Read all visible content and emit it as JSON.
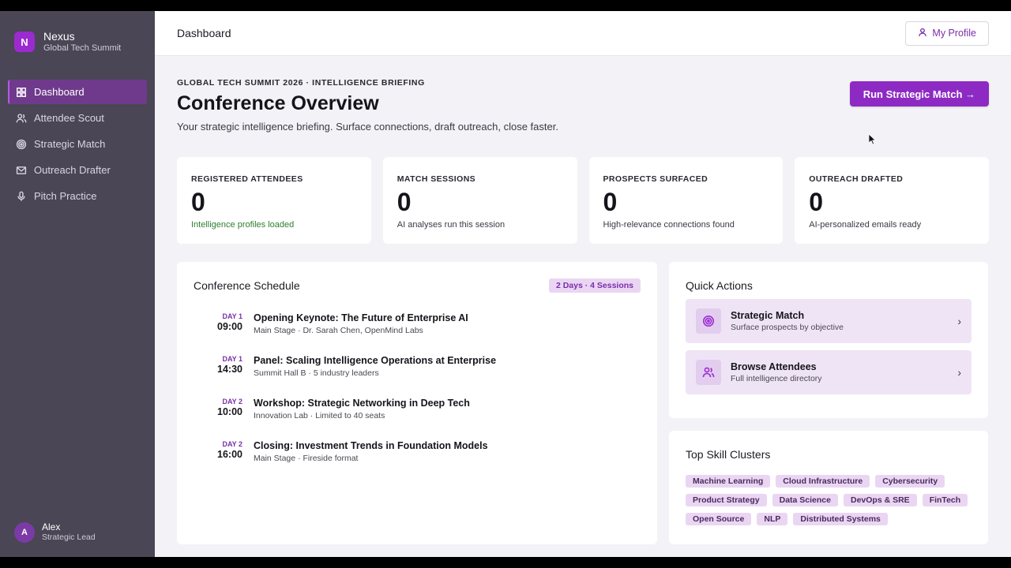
{
  "brand": {
    "logo_letter": "N",
    "name": "Nexus",
    "subtitle": "Global Tech Summit"
  },
  "nav": [
    {
      "label": "Dashboard",
      "icon": "grid-icon",
      "active": true
    },
    {
      "label": "Attendee Scout",
      "icon": "users-icon",
      "active": false
    },
    {
      "label": "Strategic Match",
      "icon": "target-icon",
      "active": false
    },
    {
      "label": "Outreach Drafter",
      "icon": "mail-icon",
      "active": false
    },
    {
      "label": "Pitch Practice",
      "icon": "mic-icon",
      "active": false
    }
  ],
  "user": {
    "initial": "A",
    "name": "Alex",
    "role": "Strategic Lead"
  },
  "topbar": {
    "title": "Dashboard",
    "profile_label": "My Profile"
  },
  "hero": {
    "kicker": "GLOBAL TECH SUMMIT 2026 · INTELLIGENCE BRIEFING",
    "title": "Conference Overview",
    "lede": "Your strategic intelligence briefing. Surface connections, draft outreach, close faster.",
    "cta": "Run Strategic Match →"
  },
  "stats": [
    {
      "label": "REGISTERED ATTENDEES",
      "value": "0",
      "note": "Intelligence profiles loaded"
    },
    {
      "label": "MATCH SESSIONS",
      "value": "0",
      "note": "AI analyses run this session"
    },
    {
      "label": "PROSPECTS SURFACED",
      "value": "0",
      "note": "High-relevance connections found"
    },
    {
      "label": "OUTREACH DRAFTED",
      "value": "0",
      "note": "AI-personalized emails ready"
    }
  ],
  "schedule": {
    "title": "Conference Schedule",
    "badge": "2 Days · 4 Sessions",
    "sessions": [
      {
        "day": "DAY 1",
        "time": "09:00",
        "title": "Opening Keynote: The Future of Enterprise AI",
        "sub": "Main Stage · Dr. Sarah Chen, OpenMind Labs"
      },
      {
        "day": "DAY 1",
        "time": "14:30",
        "title": "Panel: Scaling Intelligence Operations at Enterprise",
        "sub": "Summit Hall B · 5 industry leaders"
      },
      {
        "day": "DAY 2",
        "time": "10:00",
        "title": "Workshop: Strategic Networking in Deep Tech",
        "sub": "Innovation Lab · Limited to 40 seats"
      },
      {
        "day": "DAY 2",
        "time": "16:00",
        "title": "Closing: Investment Trends in Foundation Models",
        "sub": "Main Stage · Fireside format"
      }
    ]
  },
  "quick_actions": {
    "title": "Quick Actions",
    "items": [
      {
        "title": "Strategic Match",
        "sub": "Surface prospects by objective",
        "icon": "target-icon"
      },
      {
        "title": "Browse Attendees",
        "sub": "Full intelligence directory",
        "icon": "users-icon"
      }
    ]
  },
  "skills": {
    "title": "Top Skill Clusters",
    "tags": [
      "Machine Learning",
      "Cloud Infrastructure",
      "Cybersecurity",
      "Product Strategy",
      "Data Science",
      "DevOps & SRE",
      "FinTech",
      "Open Source",
      "NLP",
      "Distributed Systems"
    ]
  },
  "colors": {
    "accent": "#8e2ac4",
    "sidebar": "#4a4655",
    "positive": "#2e7d32"
  }
}
